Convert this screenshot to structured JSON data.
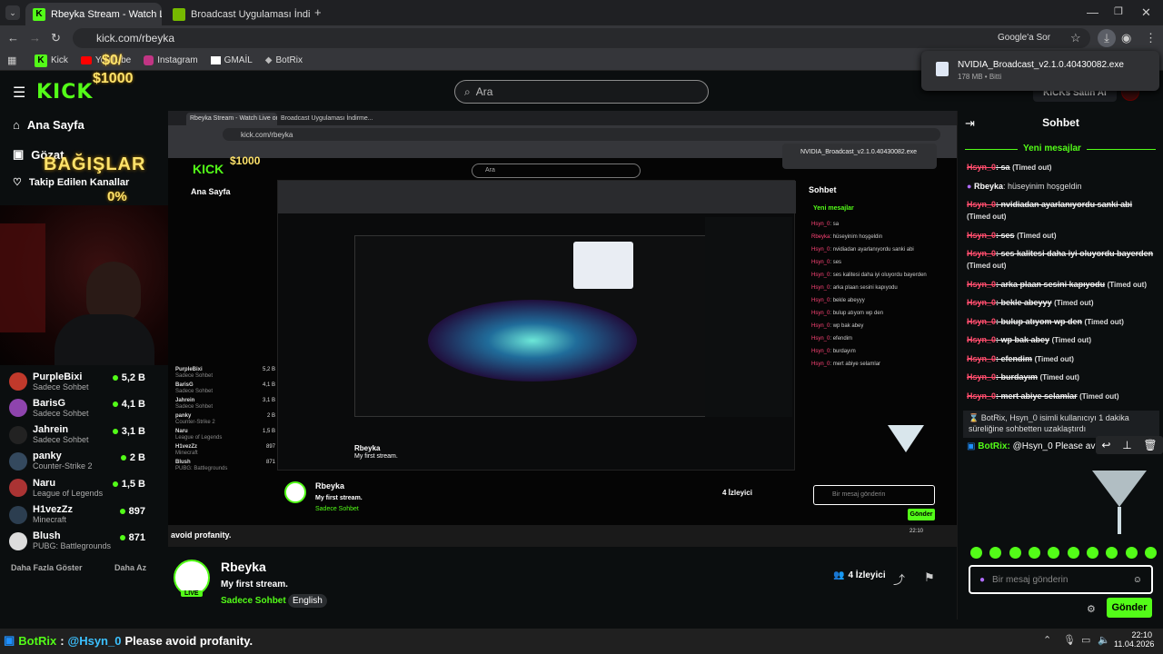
{
  "tabs": [
    {
      "label": "Rbeyka Stream - Watch Live on..."
    },
    {
      "label": "Broadcast Uygulaması İndirme..."
    }
  ],
  "address": {
    "url": "kick.com/rbeyka",
    "translate": "Google'a Sor"
  },
  "bookmarks": [
    "Kick",
    "YouTube",
    "Instagram",
    "GMAİL",
    "BotRix"
  ],
  "download": {
    "file": "NVIDIA_Broadcast_v2.1.0.40430082.exe",
    "meta": "178 MB • Bitti"
  },
  "kick": {
    "logo": "KICK",
    "search_placeholder": "Ara",
    "btn_right": "KICKs Satın Al"
  },
  "overlay": {
    "goal_top": "$0/",
    "goal_amount": "$1000",
    "donations": "BAĞIŞLAR",
    "percent": "0%"
  },
  "nav": {
    "home": "Ana Sayfa",
    "browse": "Gözat",
    "following": "Takip Edilen Kanallar"
  },
  "channels": [
    {
      "name": "PurpleBixi",
      "game": "Sadece Sohbet",
      "viewers": "5,2 B",
      "color": "#c0392b"
    },
    {
      "name": "BarisG",
      "game": "Sadece Sohbet",
      "viewers": "4,1 B",
      "color": "#8e44ad"
    },
    {
      "name": "Jahrein",
      "game": "Sadece Sohbet",
      "viewers": "3,1 B",
      "color": "#222"
    },
    {
      "name": "panky",
      "game": "Counter-Strike 2",
      "viewers": "2 B",
      "color": "#34495e"
    },
    {
      "name": "Naru",
      "game": "League of Legends",
      "viewers": "1,5 B",
      "color": "#a33"
    },
    {
      "name": "H1vezZz",
      "game": "Minecraft",
      "viewers": "897",
      "color": "#2c3e50"
    },
    {
      "name": "Blush",
      "game": "PUBG: Battlegrounds",
      "viewers": "871",
      "color": "#ddd"
    }
  ],
  "sidebar_footer": {
    "more": "Daha Fazla Göster",
    "less": "Daha Az"
  },
  "chat": {
    "title": "Sohbet",
    "new_messages": "Yeni mesajlar",
    "timed_out": "(Timed out)",
    "messages": [
      {
        "user": "Hsyn_0",
        "text": "sa",
        "timeout": true
      },
      {
        "user": "Rbeyka",
        "text": "hüseyinim hoşgeldin",
        "timeout": false
      },
      {
        "user": "Hsyn_0",
        "text": "nvidiadan ayarlanıyordu sanki abi",
        "timeout": true
      },
      {
        "user": "Hsyn_0",
        "text": "ses",
        "timeout": true
      },
      {
        "user": "Hsyn_0",
        "text": "ses kalitesi daha iyi oluyordu bayerden",
        "timeout": true
      },
      {
        "user": "Hsyn_0",
        "text": "arka plaan sesini kapıyodu",
        "timeout": true
      },
      {
        "user": "Hsyn_0",
        "text": "bekle abeyyy",
        "timeout": true
      },
      {
        "user": "Hsyn_0",
        "text": "bulup atıyom wp den",
        "timeout": true
      },
      {
        "user": "Hsyn_0",
        "text": "wp bak abey",
        "timeout": true
      },
      {
        "user": "Hsyn_0",
        "text": "efendim",
        "timeout": true
      },
      {
        "user": "Hsyn_0",
        "text": "burdayım",
        "timeout": true
      },
      {
        "user": "Hsyn_0",
        "text": "mert abiye selamlar",
        "timeout": true
      }
    ],
    "system": "BotRix, Hsyn_0 isimli kullanıcıyı 1 dakika süreliğine sohbetten uzaklaştırdı",
    "bot_user": "BotRix:",
    "bot_text": "@Hsyn_0 Please av",
    "input_placeholder": "Bir mesaj gönderin",
    "send": "Gönder"
  },
  "stream": {
    "name": "Rbeyka",
    "title": "My first stream.",
    "category": "Sadece Sohbet",
    "language": "English",
    "viewers": "4 İzleyici",
    "live": "LIVE"
  },
  "alert": {
    "user": "BotRix",
    "mention": "@Hsyn_0",
    "text": "Please avoid profanity."
  },
  "taskbar": {
    "time": "22:10",
    "date": "11.04.2026"
  },
  "inner": {
    "text1": "avoid profanity."
  }
}
